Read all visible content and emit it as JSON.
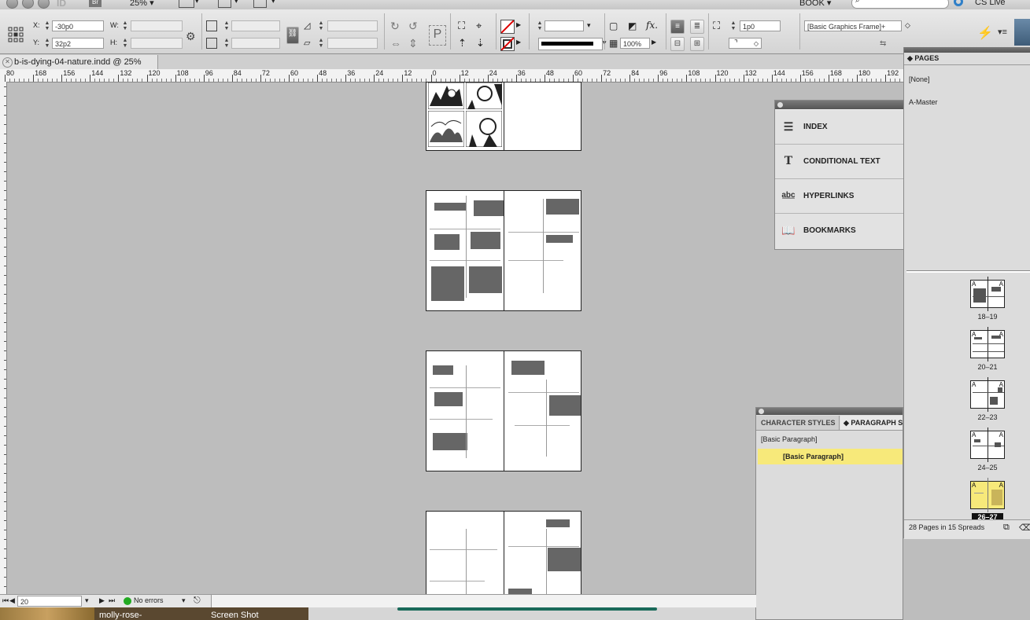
{
  "app": {
    "zoom_menu": "25%",
    "workspace": "BOOK",
    "cs_live": "CS Live"
  },
  "control": {
    "x_label": "X:",
    "x_value": "-30p0",
    "y_label": "Y:",
    "y_value": "32p2",
    "w_label": "W:",
    "h_label": "H:",
    "stroke_weight": "1p0",
    "opacity": "100%",
    "fx": "fx.",
    "object_style": "[Basic Graphics Frame]+"
  },
  "document": {
    "tab_title": "b-is-dying-04-nature.indd @ 25%"
  },
  "ruler": {
    "ticks": [
      "80",
      "168",
      "156",
      "144",
      "132",
      "120",
      "108",
      "96",
      "84",
      "72",
      "60",
      "48",
      "36",
      "24",
      "12",
      "0",
      "12",
      "24",
      "36",
      "48",
      "60",
      "72",
      "84",
      "96",
      "108",
      "120",
      "132",
      "144",
      "156",
      "168",
      "180",
      "192"
    ]
  },
  "panels": {
    "index": "INDEX",
    "conditional_text": "CONDITIONAL TEXT",
    "hyperlinks": "HYPERLINKS",
    "bookmarks": "BOOKMARKS"
  },
  "pages": {
    "title": "PAGES",
    "none": "[None]",
    "master": "A-Master",
    "spreads": [
      {
        "label": "18–19"
      },
      {
        "label": "20–21"
      },
      {
        "label": "22–23"
      },
      {
        "label": "24–25"
      },
      {
        "label": "26–27",
        "selected": true
      }
    ],
    "footer": "28 Pages in 15 Spreads"
  },
  "styles": {
    "tab_character": "CHARACTER STYLES",
    "tab_paragraph": "PARAGRAPH ST",
    "current": "[Basic Paragraph]",
    "selected_item": "[Basic Paragraph]"
  },
  "status": {
    "page": "20",
    "preflight": "No errors"
  },
  "desktop": {
    "item1": "molly-rose-",
    "item2": "Screen Shot"
  },
  "colors": {
    "highlight": "#f7e97a",
    "status_ok": "#22aa22"
  }
}
